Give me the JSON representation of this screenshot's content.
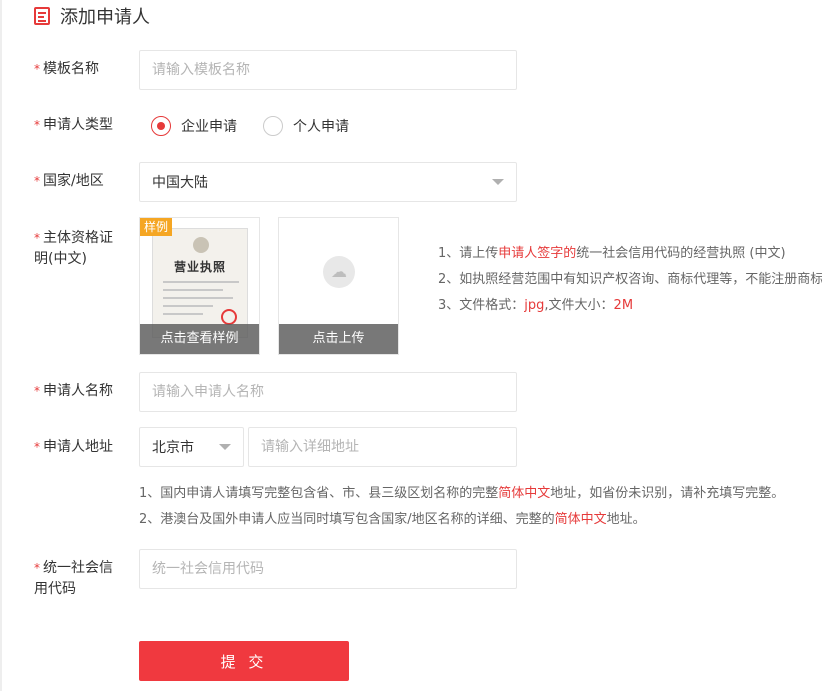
{
  "header": {
    "title": "添加申请人",
    "icon": "document-icon"
  },
  "form": {
    "template_name": {
      "label": "模板名称",
      "placeholder": "请输入模板名称",
      "value": ""
    },
    "applicant_type": {
      "label": "申请人类型",
      "options": [
        {
          "label": "企业申请",
          "checked": true
        },
        {
          "label": "个人申请",
          "checked": false
        }
      ]
    },
    "region": {
      "label": "国家/地区",
      "value": "中国大陆"
    },
    "license": {
      "label_line1": "主体资格证",
      "label_line2": "明(中文)",
      "sample_tag": "样例",
      "sample_caption": "点击查看样例",
      "license_title": "营业执照",
      "upload_caption": "点击上传",
      "notes": {
        "n1_prefix": "1、请上传",
        "n1_highlight": "申请人签字的",
        "n1_suffix": "统一社会信用代码的经营执照 (中文)",
        "n2": "2、如执照经营范围中有知识产权咨询、商标代理等，不能注册商标。",
        "n3_prefix": "3、文件格式：",
        "n3_format": "jpg",
        "n3_mid": ",文件大小：",
        "n3_size": "2M"
      }
    },
    "applicant_name": {
      "label": "申请人名称",
      "placeholder": "请输入申请人名称",
      "value": ""
    },
    "applicant_address": {
      "label": "申请人地址",
      "city": "北京市",
      "placeholder": "请输入详细地址",
      "value": "",
      "notes": {
        "a1_prefix": "1、国内申请人请填写完整包含省、市、县三级区划名称的完整",
        "a1_highlight": "简体中文",
        "a1_suffix": "地址，如省份未识别，请补充填写完整。",
        "a2_prefix": "2、港澳台及国外申请人应当同时填写包含国家/地区名称的详细、完整的",
        "a2_highlight": "简体中文",
        "a2_suffix": "地址。"
      }
    },
    "credit_code": {
      "label_line1": "统一社会信",
      "label_line2": "用代码",
      "placeholder": "统一社会信用代码",
      "value": ""
    },
    "required_mark": "*"
  },
  "submit_label": "提 交",
  "colors": {
    "accent": "#e63a3a",
    "submit_bg": "#f0393f",
    "sample_tag": "#f5a623"
  }
}
